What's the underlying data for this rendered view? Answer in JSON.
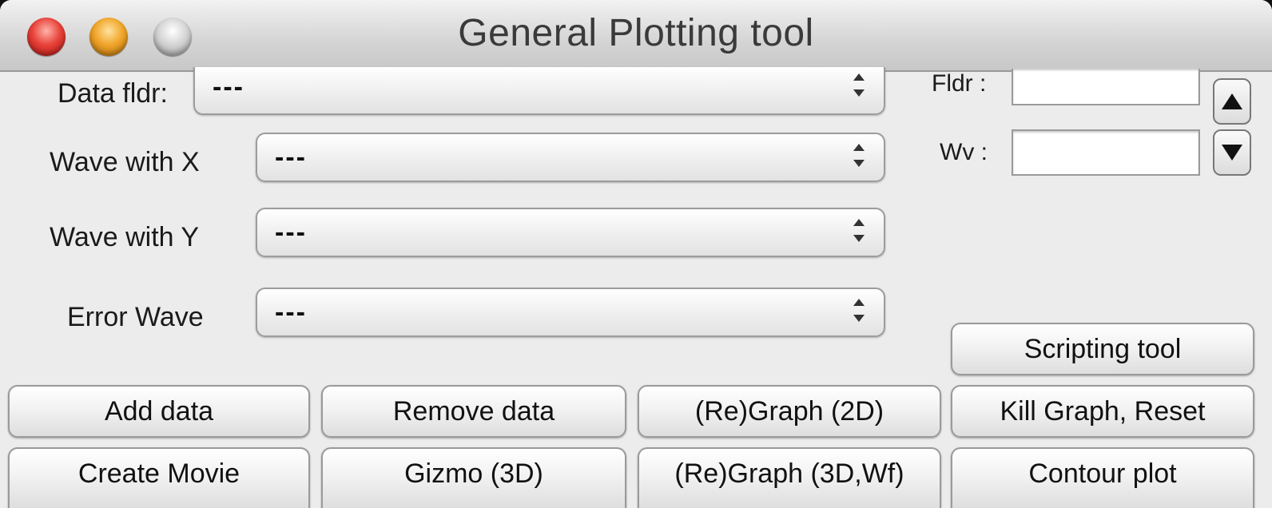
{
  "window": {
    "title": "General Plotting tool",
    "controls": [
      "close",
      "minimize",
      "zoom"
    ]
  },
  "form": {
    "data_folder": {
      "label": "Data fldr:",
      "value": "---"
    },
    "wave_x": {
      "label": "Wave with X",
      "value": "---"
    },
    "wave_y": {
      "label": "Wave with Y",
      "value": "---"
    },
    "error_wave": {
      "label": "Error Wave",
      "value": "---"
    }
  },
  "side": {
    "folder_label": "Fldr :",
    "folder_value": "",
    "wave_label": "Wv :",
    "wave_value": "",
    "up_icon": "triangle-up-icon",
    "down_icon": "triangle-down-icon"
  },
  "buttons": {
    "scripting_tool": "Scripting tool",
    "add_data": "Add data",
    "remove_data": "Remove data",
    "regraph_2d": "(Re)Graph (2D)",
    "kill_graph": "Kill Graph, Reset",
    "create_movie": "Create Movie",
    "gizmo_3d": "Gizmo (3D)",
    "regraph_3d": "(Re)Graph (3D,Wf)",
    "contour_plot": "Contour plot"
  },
  "colors": {
    "close": "#e8423a",
    "minimize": "#f0a52a",
    "zoom": "#cfcfcf",
    "window_bg": "#ececec"
  }
}
